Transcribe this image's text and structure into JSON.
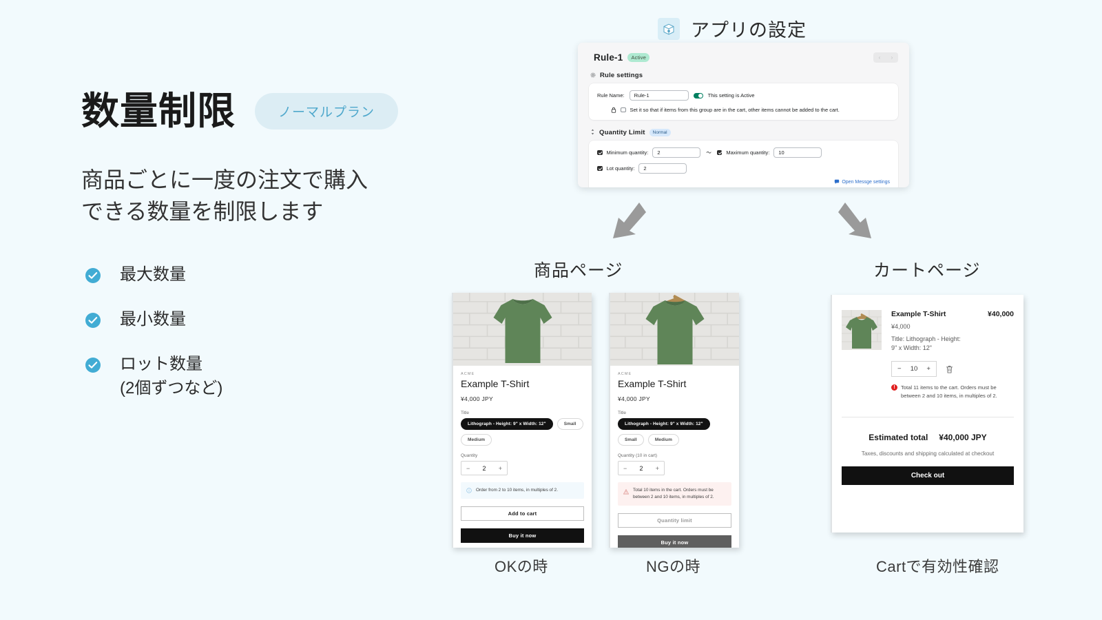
{
  "page": {
    "background": "#f2fafd",
    "accent": "#42acd4"
  },
  "left": {
    "title": "数量制限",
    "plan_badge": "ノーマルプラン",
    "lead_line1": "商品ごとに一度の注文で購入",
    "lead_line2": "できる数量を制限します",
    "features": [
      {
        "label": "最大数量"
      },
      {
        "label": "最小数量"
      },
      {
        "label": "ロット数量\n(2個ずつなど)"
      }
    ]
  },
  "app_settings_header": {
    "icon": "locked-box-icon",
    "label": "アプリの設定"
  },
  "settings_window": {
    "back_icon": "arrow-left-icon",
    "rule_title": "Rule-1",
    "status_badge": "Active",
    "pager_prev": "‹",
    "pager_next": "›",
    "section_rule": {
      "icon": "gear-icon",
      "title": "Rule settings",
      "rule_name_label": "Rule Name:",
      "rule_name_value": "Rule-1",
      "toggle_label": "This setting is Active",
      "lock_icon": "lock-icon",
      "exclusive_checkbox_label": "Set it so that if items from this group are in the cart, other items cannot be added to the cart.",
      "exclusive_checked": false
    },
    "section_quantity": {
      "icon": "updown-arrows-icon",
      "title": "Quantity Limit",
      "badge": "Normal",
      "minimum_label": "Minimum quantity:",
      "minimum_value": "2",
      "minimum_checked": true,
      "tilde": "〜",
      "maximum_label": "Maximum quantity:",
      "maximum_value": "10",
      "maximum_checked": true,
      "lot_label": "Lot quantity:",
      "lot_value": "2",
      "lot_checked": true,
      "message_link": "Open Messge settings",
      "message_link_icon": "chat-icon"
    }
  },
  "captions": {
    "product_page": "商品ページ",
    "cart_page": "カートページ",
    "ok_case": "OKの時",
    "ng_case": "NGの時",
    "cart_validation": "Cartで有効性確認"
  },
  "product_ok": {
    "vendor": "ACME",
    "name": "Example T-Shirt",
    "price": "¥4,000 JPY",
    "option_label": "Title",
    "options": [
      {
        "label": "Lithograph - Height: 9\" x Width: 12\"",
        "selected": true
      },
      {
        "label": "Small",
        "selected": false
      },
      {
        "label": "Medium",
        "selected": false
      }
    ],
    "quantity_label": "Quantity",
    "quantity_value": "2",
    "minus": "−",
    "plus": "+",
    "notice_icon": "info-icon",
    "notice": "Order from 2 to 10 items, in multiples of 2.",
    "button_add": "Add to cart",
    "button_buy": "Buy it now"
  },
  "product_ng": {
    "vendor": "ACME",
    "name": "Example T-Shirt",
    "price": "¥4,000 JPY",
    "option_label": "Title",
    "options": [
      {
        "label": "Lithograph - Height: 9\" x Width: 12\"",
        "selected": true
      },
      {
        "label": "Small",
        "selected": false
      },
      {
        "label": "Medium",
        "selected": false
      }
    ],
    "quantity_label": "Quantity (10 in cart)",
    "quantity_value": "2",
    "minus": "−",
    "plus": "+",
    "notice_icon": "warning-icon",
    "notice": "Total 10 items in the cart. Orders must be between 2 and 10 items, in multiples of 2.",
    "button_add": "Quantity limit",
    "button_buy": "Buy it now"
  },
  "cart": {
    "item_name": "Example T-Shirt",
    "item_amount": "¥40,000",
    "item_price": "¥4,000",
    "item_variant_line1": "Title: Lithograph - Height:",
    "item_variant_line2": "9\" x Width: 12\"",
    "quantity_value": "10",
    "minus": "−",
    "plus": "+",
    "remove_icon": "trash-icon",
    "error_icon": "error-icon",
    "error_line1": "Total 11 items to the cart. Orders must be",
    "error_line2": "between 2 and 10 items, in multiples of 2.",
    "estimated_total_label": "Estimated total",
    "estimated_total_value": "¥40,000 JPY",
    "tax_note": "Taxes, discounts and shipping calculated at checkout",
    "checkout_button": "Check out"
  }
}
